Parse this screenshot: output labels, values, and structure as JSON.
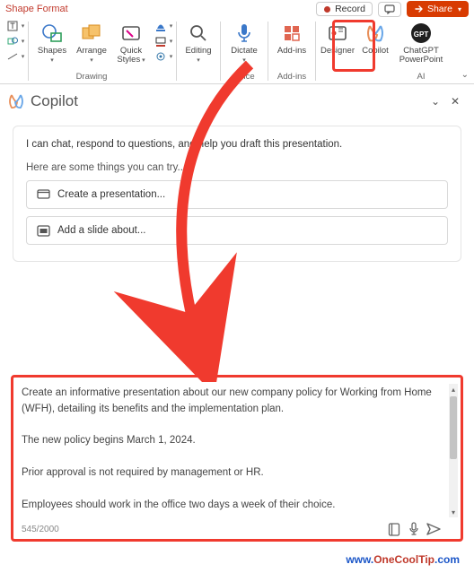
{
  "titlebar": {
    "tab_label": "Shape Format",
    "record_label": "Record",
    "share_label": "Share"
  },
  "ribbon": {
    "shapes_label": "Shapes",
    "arrange_label": "Arrange",
    "quick_styles_label": "Quick\nStyles",
    "drawing_group": "Drawing",
    "editing_label": "Editing",
    "dictate_label": "Dictate",
    "voice_group": "Voice",
    "addins_label": "Add-ins",
    "addins_group": "Add-ins",
    "designer_label": "Designer",
    "copilot_label": "Copilot",
    "chatgpt_label": "ChatGPT\nPowerPoint",
    "ai_group": "AI"
  },
  "pane": {
    "title": "Copilot"
  },
  "card": {
    "intro": "I can chat, respond to questions, and help you draft this presentation.",
    "hint": "Here are some things you can try...",
    "suggest_create": "Create a presentation...",
    "suggest_add": "Add a slide about..."
  },
  "input": {
    "text": "Create an informative presentation about our new company policy for Working from Home (WFH), detailing its benefits and the implementation plan.\n\nThe new policy begins March 1, 2024.\n\nPrior approval is not required by management or HR.\n\nEmployees should work in the office two days a week of their choice.",
    "counter": "545/2000"
  },
  "watermark": {
    "prefix": "www.",
    "domain": "OneCoolTip",
    "suffix": ".com"
  }
}
